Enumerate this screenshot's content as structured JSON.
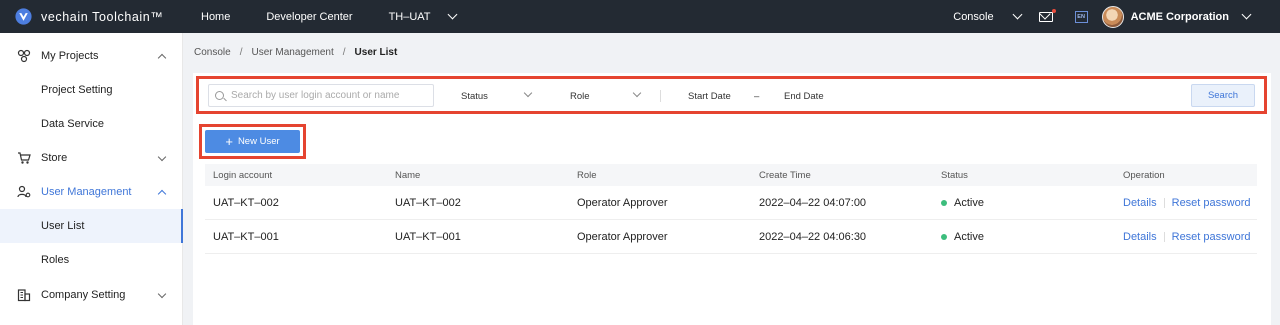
{
  "topbar": {
    "brand": "vechain Toolchain™",
    "nav": [
      "Home",
      "Developer Center",
      "TH–UAT"
    ],
    "console_label": "Console",
    "lang": "EN",
    "org_name": "ACME Corporation"
  },
  "sidebar": {
    "items": [
      {
        "label": "My Projects",
        "icon": "projects-icon"
      },
      {
        "label": "Project Setting"
      },
      {
        "label": "Data Service"
      },
      {
        "label": "Store",
        "icon": "store-icon"
      },
      {
        "label": "User Management",
        "icon": "user-management-icon"
      },
      {
        "label": "User List"
      },
      {
        "label": "Roles"
      },
      {
        "label": "Company Setting",
        "icon": "company-icon"
      }
    ]
  },
  "breadcrumb": [
    "Console",
    "User Management",
    "User List"
  ],
  "filters": {
    "search_placeholder": "Search by user login account or name",
    "status_label": "Status",
    "role_label": "Role",
    "start_date": "Start Date",
    "date_sep": "–",
    "end_date": "End Date",
    "search_button": "Search"
  },
  "new_user_button": "New User",
  "table": {
    "columns": [
      "Login account",
      "Name",
      "Role",
      "Create Time",
      "Status",
      "Operation"
    ],
    "rows": [
      {
        "login": "UAT–KT–002",
        "name": "UAT–KT–002",
        "role": "Operator Approver",
        "created": "2022–04–22 04:07:00",
        "status": "Active"
      },
      {
        "login": "UAT–KT–001",
        "name": "UAT–KT–001",
        "role": "Operator Approver",
        "created": "2022–04–22 04:06:30",
        "status": "Active"
      }
    ],
    "op_details": "Details",
    "op_reset": "Reset password"
  },
  "colors": {
    "accent": "#3f76d8",
    "highlight_border": "#e54430",
    "active_status": "#3dbd7d",
    "topbar": "#232a33"
  }
}
